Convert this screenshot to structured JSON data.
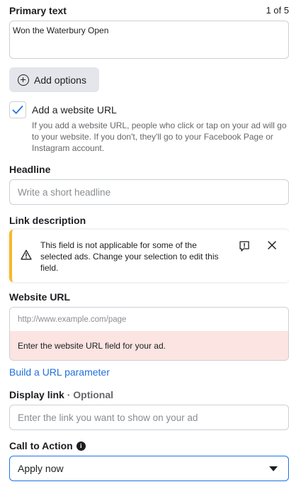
{
  "primary_text": {
    "label": "Primary text",
    "counter": "1 of 5",
    "value": "Won the Waterbury Open"
  },
  "add_options": {
    "label": "Add options",
    "icon": "plus-circle-icon"
  },
  "website_url_checkbox": {
    "label": "Add a website URL",
    "checked": true,
    "help": "If you add a website URL, people who click or tap on your ad will go to your website. If you don't, they'll go to your Facebook Page or Instagram account."
  },
  "headline": {
    "label": "Headline",
    "placeholder": "Write a short headline"
  },
  "link_description": {
    "label": "Link description",
    "warning": "This field is not applicable for some of the selected ads. Change your selection to edit this field.",
    "warning_color": "#f7b928"
  },
  "website_url": {
    "label": "Website URL",
    "placeholder": "http://www.example.com/page",
    "error": "Enter the website URL field for your ad.",
    "error_bg": "#fbe4e1"
  },
  "build_url_parameter": {
    "label": "Build a URL parameter",
    "color": "#216fdb"
  },
  "display_link": {
    "label": "Display link",
    "optional": " · Optional",
    "placeholder": "Enter the link you want to show on your ad"
  },
  "call_to_action": {
    "label": "Call to Action",
    "value": "Apply now",
    "accent": "#1b74e4"
  }
}
